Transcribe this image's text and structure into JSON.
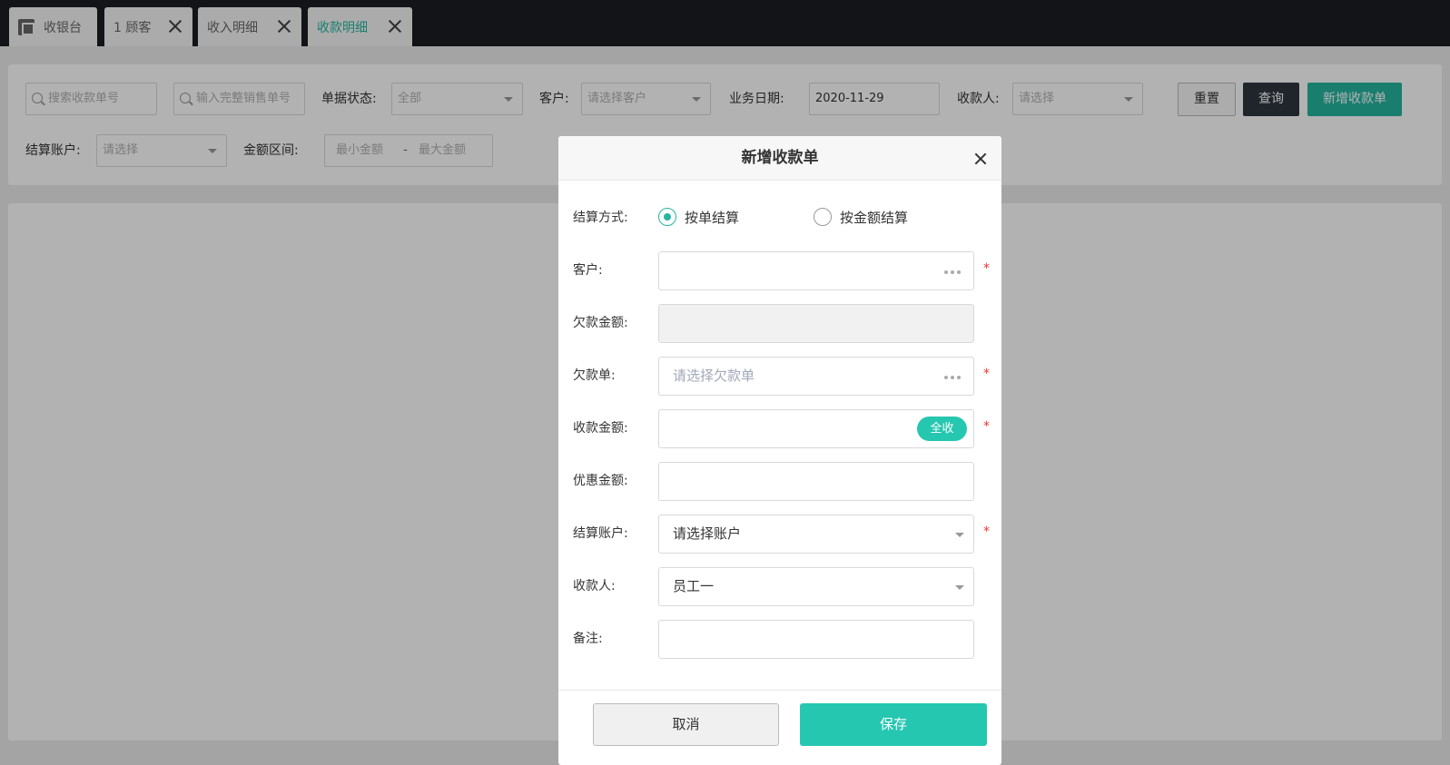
{
  "tabs": [
    {
      "label": "收银台"
    },
    {
      "label": "1 顾客"
    },
    {
      "label": "收入明细"
    },
    {
      "label": "收款明细"
    }
  ],
  "filters": {
    "search_receipt_placeholder": "搜索收款单号",
    "search_sale_placeholder": "输入完整销售单号",
    "status_label": "单据状态:",
    "status_value": "全部",
    "customer_label": "客户:",
    "customer_placeholder": "请选择客户",
    "date_label": "业务日期:",
    "date_value": "2020-11-29",
    "payee_label": "收款人:",
    "payee_placeholder": "请选择",
    "account_label": "结算账户:",
    "account_placeholder": "请选择",
    "amount_label": "金额区间:",
    "amount_min_placeholder": "最小金额",
    "amount_sep": "-",
    "amount_max_placeholder": "最大金额",
    "reset_label": "重置",
    "query_label": "查询",
    "add_label": "新增收款单"
  },
  "modal": {
    "title": "新增收款单",
    "settle_method_label": "结算方式:",
    "radio_by_order": "按单结算",
    "radio_by_amount": "按金额结算",
    "selected_method": "按单结算",
    "customer_label": "客户:",
    "customer_value": "",
    "debt_amount_label": "欠款金额:",
    "debt_amount_value": "",
    "debt_order_label": "欠款单:",
    "debt_order_placeholder": "请选择欠款单",
    "receive_amount_label": "收款金额:",
    "receive_amount_value": "",
    "receive_all_label": "全收",
    "discount_label": "优惠金额:",
    "discount_value": "",
    "account_label": "结算账户:",
    "account_value": "请选择账户",
    "payee_label": "收款人:",
    "payee_value": "员工一",
    "remark_label": "备注:",
    "remark_value": "",
    "required_mark": "*",
    "cancel_label": "取消",
    "save_label": "保存"
  },
  "colors": {
    "accent": "#26b5a0",
    "accent_bright": "#26c7b0",
    "topbar": "#1b1d22",
    "required": "#ee3333"
  }
}
